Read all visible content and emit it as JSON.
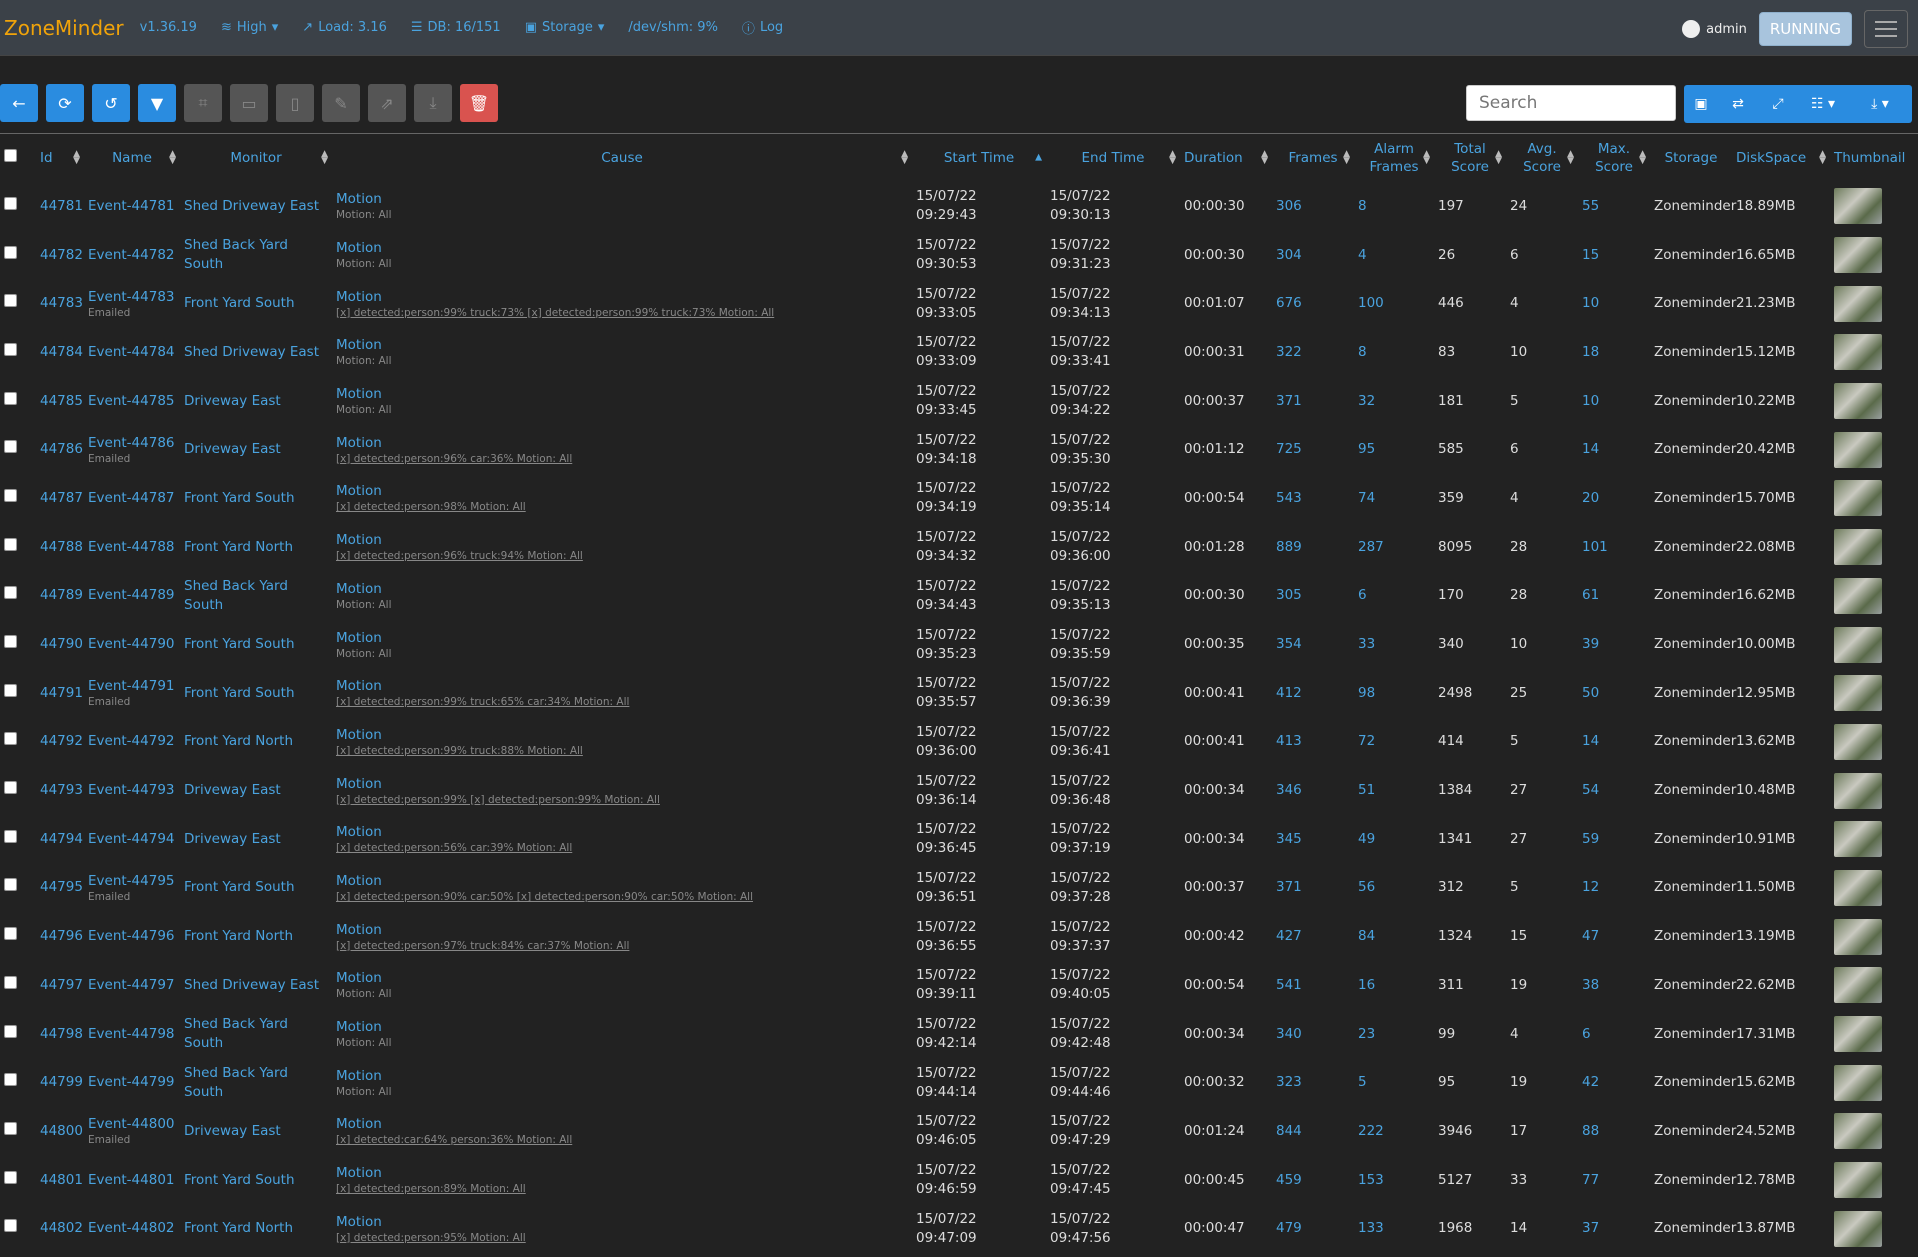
{
  "nav": {
    "brand": "ZoneMinder",
    "version": "v1.36.19",
    "bandwidth": "High",
    "load": "Load: 3.16",
    "db": "DB: 16/151",
    "storage": "Storage",
    "shm": "/dev/shm: 9%",
    "log": "Log",
    "user": "admin",
    "state": "RUNNING"
  },
  "toolbar": {
    "search_placeholder": "Search"
  },
  "columns": [
    "Id",
    "Name",
    "Monitor",
    "Cause",
    "Start Time",
    "End Time",
    "Duration",
    "Frames",
    "Alarm Frames",
    "Total Score",
    "Avg. Score",
    "Max. Score",
    "Storage",
    "DiskSpace",
    "Thumbnail"
  ],
  "rows": [
    {
      "id": "44781",
      "name": "Event-44781",
      "emailed": "",
      "monitor": "Shed Driveway East",
      "cause": "Motion",
      "detail": "Motion: All",
      "linked": false,
      "start_d": "15/07/22",
      "start_t": "09:29:43",
      "end_d": "15/07/22",
      "end_t": "09:30:13",
      "duration": "00:00:30",
      "frames": "306",
      "alarm": "8",
      "total": "197",
      "avg": "24",
      "max": "55",
      "storage": "Zoneminder",
      "disk": "18.89MB"
    },
    {
      "id": "44782",
      "name": "Event-44782",
      "emailed": "",
      "monitor": "Shed Back Yard South",
      "cause": "Motion",
      "detail": "Motion: All",
      "linked": false,
      "start_d": "15/07/22",
      "start_t": "09:30:53",
      "end_d": "15/07/22",
      "end_t": "09:31:23",
      "duration": "00:00:30",
      "frames": "304",
      "alarm": "4",
      "total": "26",
      "avg": "6",
      "max": "15",
      "storage": "Zoneminder",
      "disk": "16.65MB"
    },
    {
      "id": "44783",
      "name": "Event-44783",
      "emailed": "Emailed",
      "monitor": "Front Yard South",
      "cause": "Motion",
      "detail": "[x] detected:person:99% truck:73% [x] detected:person:99% truck:73% Motion: All",
      "linked": true,
      "start_d": "15/07/22",
      "start_t": "09:33:05",
      "end_d": "15/07/22",
      "end_t": "09:34:13",
      "duration": "00:01:07",
      "frames": "676",
      "alarm": "100",
      "total": "446",
      "avg": "4",
      "max": "10",
      "storage": "Zoneminder",
      "disk": "21.23MB"
    },
    {
      "id": "44784",
      "name": "Event-44784",
      "emailed": "",
      "monitor": "Shed Driveway East",
      "cause": "Motion",
      "detail": "Motion: All",
      "linked": false,
      "start_d": "15/07/22",
      "start_t": "09:33:09",
      "end_d": "15/07/22",
      "end_t": "09:33:41",
      "duration": "00:00:31",
      "frames": "322",
      "alarm": "8",
      "total": "83",
      "avg": "10",
      "max": "18",
      "storage": "Zoneminder",
      "disk": "15.12MB"
    },
    {
      "id": "44785",
      "name": "Event-44785",
      "emailed": "",
      "monitor": "Driveway East",
      "cause": "Motion",
      "detail": "Motion: All",
      "linked": false,
      "start_d": "15/07/22",
      "start_t": "09:33:45",
      "end_d": "15/07/22",
      "end_t": "09:34:22",
      "duration": "00:00:37",
      "frames": "371",
      "alarm": "32",
      "total": "181",
      "avg": "5",
      "max": "10",
      "storage": "Zoneminder",
      "disk": "10.22MB"
    },
    {
      "id": "44786",
      "name": "Event-44786",
      "emailed": "Emailed",
      "monitor": "Driveway East",
      "cause": "Motion",
      "detail": "[x] detected:person:96% car:36% Motion: All",
      "linked": true,
      "start_d": "15/07/22",
      "start_t": "09:34:18",
      "end_d": "15/07/22",
      "end_t": "09:35:30",
      "duration": "00:01:12",
      "frames": "725",
      "alarm": "95",
      "total": "585",
      "avg": "6",
      "max": "14",
      "storage": "Zoneminder",
      "disk": "20.42MB"
    },
    {
      "id": "44787",
      "name": "Event-44787",
      "emailed": "",
      "monitor": "Front Yard South",
      "cause": "Motion",
      "detail": "[x] detected:person:98% Motion: All",
      "linked": true,
      "start_d": "15/07/22",
      "start_t": "09:34:19",
      "end_d": "15/07/22",
      "end_t": "09:35:14",
      "duration": "00:00:54",
      "frames": "543",
      "alarm": "74",
      "total": "359",
      "avg": "4",
      "max": "20",
      "storage": "Zoneminder",
      "disk": "15.70MB"
    },
    {
      "id": "44788",
      "name": "Event-44788",
      "emailed": "",
      "monitor": "Front Yard North",
      "cause": "Motion",
      "detail": "[x] detected:person:96% truck:94% Motion: All",
      "linked": true,
      "start_d": "15/07/22",
      "start_t": "09:34:32",
      "end_d": "15/07/22",
      "end_t": "09:36:00",
      "duration": "00:01:28",
      "frames": "889",
      "alarm": "287",
      "total": "8095",
      "avg": "28",
      "max": "101",
      "storage": "Zoneminder",
      "disk": "22.08MB"
    },
    {
      "id": "44789",
      "name": "Event-44789",
      "emailed": "",
      "monitor": "Shed Back Yard South",
      "cause": "Motion",
      "detail": "Motion: All",
      "linked": false,
      "start_d": "15/07/22",
      "start_t": "09:34:43",
      "end_d": "15/07/22",
      "end_t": "09:35:13",
      "duration": "00:00:30",
      "frames": "305",
      "alarm": "6",
      "total": "170",
      "avg": "28",
      "max": "61",
      "storage": "Zoneminder",
      "disk": "16.62MB"
    },
    {
      "id": "44790",
      "name": "Event-44790",
      "emailed": "",
      "monitor": "Front Yard South",
      "cause": "Motion",
      "detail": "Motion: All",
      "linked": false,
      "start_d": "15/07/22",
      "start_t": "09:35:23",
      "end_d": "15/07/22",
      "end_t": "09:35:59",
      "duration": "00:00:35",
      "frames": "354",
      "alarm": "33",
      "total": "340",
      "avg": "10",
      "max": "39",
      "storage": "Zoneminder",
      "disk": "10.00MB"
    },
    {
      "id": "44791",
      "name": "Event-44791",
      "emailed": "Emailed",
      "monitor": "Front Yard South",
      "cause": "Motion",
      "detail": "[x] detected:person:99% truck:65% car:34% Motion: All",
      "linked": true,
      "start_d": "15/07/22",
      "start_t": "09:35:57",
      "end_d": "15/07/22",
      "end_t": "09:36:39",
      "duration": "00:00:41",
      "frames": "412",
      "alarm": "98",
      "total": "2498",
      "avg": "25",
      "max": "50",
      "storage": "Zoneminder",
      "disk": "12.95MB"
    },
    {
      "id": "44792",
      "name": "Event-44792",
      "emailed": "",
      "monitor": "Front Yard North",
      "cause": "Motion",
      "detail": "[x] detected:person:99% truck:88% Motion: All",
      "linked": true,
      "start_d": "15/07/22",
      "start_t": "09:36:00",
      "end_d": "15/07/22",
      "end_t": "09:36:41",
      "duration": "00:00:41",
      "frames": "413",
      "alarm": "72",
      "total": "414",
      "avg": "5",
      "max": "14",
      "storage": "Zoneminder",
      "disk": "13.62MB"
    },
    {
      "id": "44793",
      "name": "Event-44793",
      "emailed": "",
      "monitor": "Driveway East",
      "cause": "Motion",
      "detail": "[x] detected:person:99% [x] detected:person:99% Motion: All",
      "linked": true,
      "start_d": "15/07/22",
      "start_t": "09:36:14",
      "end_d": "15/07/22",
      "end_t": "09:36:48",
      "duration": "00:00:34",
      "frames": "346",
      "alarm": "51",
      "total": "1384",
      "avg": "27",
      "max": "54",
      "storage": "Zoneminder",
      "disk": "10.48MB"
    },
    {
      "id": "44794",
      "name": "Event-44794",
      "emailed": "",
      "monitor": "Driveway East",
      "cause": "Motion",
      "detail": "[x] detected:person:56% car:39% Motion: All",
      "linked": true,
      "start_d": "15/07/22",
      "start_t": "09:36:45",
      "end_d": "15/07/22",
      "end_t": "09:37:19",
      "duration": "00:00:34",
      "frames": "345",
      "alarm": "49",
      "total": "1341",
      "avg": "27",
      "max": "59",
      "storage": "Zoneminder",
      "disk": "10.91MB"
    },
    {
      "id": "44795",
      "name": "Event-44795",
      "emailed": "Emailed",
      "monitor": "Front Yard South",
      "cause": "Motion",
      "detail": "[x] detected:person:90% car:50% [x] detected:person:90% car:50% Motion: All",
      "linked": true,
      "start_d": "15/07/22",
      "start_t": "09:36:51",
      "end_d": "15/07/22",
      "end_t": "09:37:28",
      "duration": "00:00:37",
      "frames": "371",
      "alarm": "56",
      "total": "312",
      "avg": "5",
      "max": "12",
      "storage": "Zoneminder",
      "disk": "11.50MB"
    },
    {
      "id": "44796",
      "name": "Event-44796",
      "emailed": "",
      "monitor": "Front Yard North",
      "cause": "Motion",
      "detail": "[x] detected:person:97% truck:84% car:37% Motion: All",
      "linked": true,
      "start_d": "15/07/22",
      "start_t": "09:36:55",
      "end_d": "15/07/22",
      "end_t": "09:37:37",
      "duration": "00:00:42",
      "frames": "427",
      "alarm": "84",
      "total": "1324",
      "avg": "15",
      "max": "47",
      "storage": "Zoneminder",
      "disk": "13.19MB"
    },
    {
      "id": "44797",
      "name": "Event-44797",
      "emailed": "",
      "monitor": "Shed Driveway East",
      "cause": "Motion",
      "detail": "Motion: All",
      "linked": false,
      "start_d": "15/07/22",
      "start_t": "09:39:11",
      "end_d": "15/07/22",
      "end_t": "09:40:05",
      "duration": "00:00:54",
      "frames": "541",
      "alarm": "16",
      "total": "311",
      "avg": "19",
      "max": "38",
      "storage": "Zoneminder",
      "disk": "22.62MB"
    },
    {
      "id": "44798",
      "name": "Event-44798",
      "emailed": "",
      "monitor": "Shed Back Yard South",
      "cause": "Motion",
      "detail": "Motion: All",
      "linked": false,
      "start_d": "15/07/22",
      "start_t": "09:42:14",
      "end_d": "15/07/22",
      "end_t": "09:42:48",
      "duration": "00:00:34",
      "frames": "340",
      "alarm": "23",
      "total": "99",
      "avg": "4",
      "max": "6",
      "storage": "Zoneminder",
      "disk": "17.31MB"
    },
    {
      "id": "44799",
      "name": "Event-44799",
      "emailed": "",
      "monitor": "Shed Back Yard South",
      "cause": "Motion",
      "detail": "Motion: All",
      "linked": false,
      "start_d": "15/07/22",
      "start_t": "09:44:14",
      "end_d": "15/07/22",
      "end_t": "09:44:46",
      "duration": "00:00:32",
      "frames": "323",
      "alarm": "5",
      "total": "95",
      "avg": "19",
      "max": "42",
      "storage": "Zoneminder",
      "disk": "15.62MB"
    },
    {
      "id": "44800",
      "name": "Event-44800",
      "emailed": "Emailed",
      "monitor": "Driveway East",
      "cause": "Motion",
      "detail": "[x] detected:car:64% person:36% Motion: All",
      "linked": true,
      "start_d": "15/07/22",
      "start_t": "09:46:05",
      "end_d": "15/07/22",
      "end_t": "09:47:29",
      "duration": "00:01:24",
      "frames": "844",
      "alarm": "222",
      "total": "3946",
      "avg": "17",
      "max": "88",
      "storage": "Zoneminder",
      "disk": "24.52MB"
    },
    {
      "id": "44801",
      "name": "Event-44801",
      "emailed": "",
      "monitor": "Front Yard South",
      "cause": "Motion",
      "detail": "[x] detected:person:89% Motion: All",
      "linked": true,
      "start_d": "15/07/22",
      "start_t": "09:46:59",
      "end_d": "15/07/22",
      "end_t": "09:47:45",
      "duration": "00:00:45",
      "frames": "459",
      "alarm": "153",
      "total": "5127",
      "avg": "33",
      "max": "77",
      "storage": "Zoneminder",
      "disk": "12.78MB"
    },
    {
      "id": "44802",
      "name": "Event-44802",
      "emailed": "",
      "monitor": "Front Yard North",
      "cause": "Motion",
      "detail": "[x] detected:person:95% Motion: All",
      "linked": true,
      "start_d": "15/07/22",
      "start_t": "09:47:09",
      "end_d": "15/07/22",
      "end_t": "09:47:56",
      "duration": "00:00:47",
      "frames": "479",
      "alarm": "133",
      "total": "1968",
      "avg": "14",
      "max": "37",
      "storage": "Zoneminder",
      "disk": "13.87MB"
    }
  ]
}
